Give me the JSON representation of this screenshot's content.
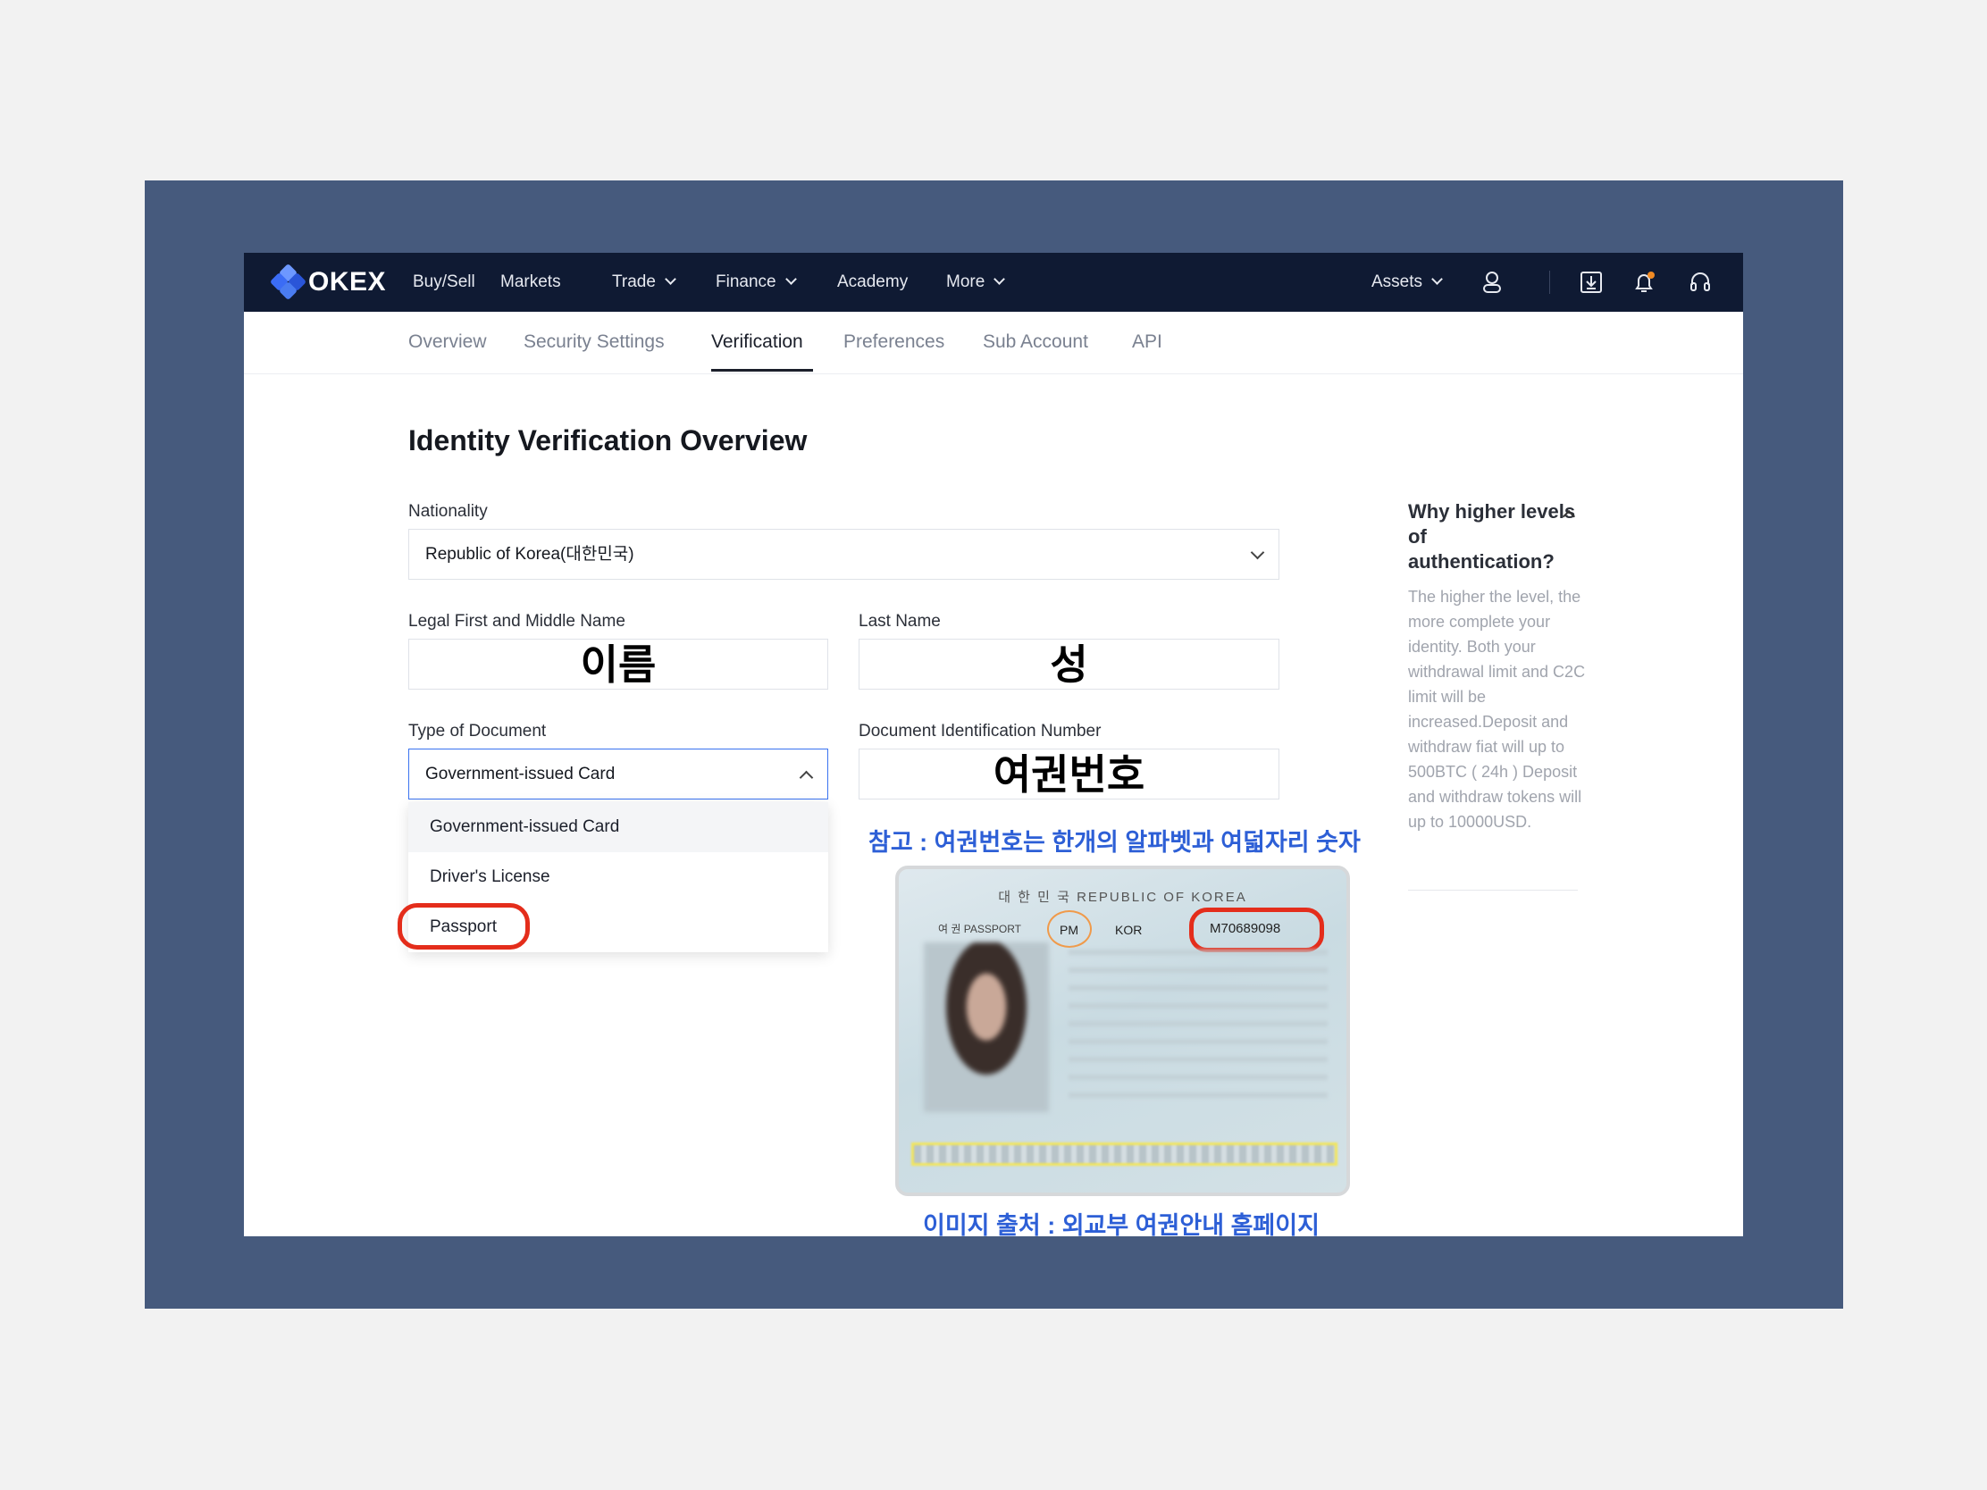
{
  "brand": {
    "name": "OKEX"
  },
  "topnav": {
    "items": [
      "Buy/Sell",
      "Markets",
      "Trade",
      "Finance",
      "Academy",
      "More"
    ],
    "assets_label": "Assets"
  },
  "subnav": {
    "tabs": [
      "Overview",
      "Security Settings",
      "Verification",
      "Preferences",
      "Sub Account",
      "API"
    ],
    "active": "Verification"
  },
  "page": {
    "title": "Identity Verification Overview"
  },
  "form": {
    "nationality_label": "Nationality",
    "nationality_value": "Republic of Korea(대한민국)",
    "first_name_label": "Legal First and Middle Name",
    "first_name_value": "이름",
    "last_name_label": "Last Name",
    "last_name_value": "성",
    "doc_type_label": "Type of Document",
    "doc_type_value": "Government-issued Card",
    "doc_number_label": "Document Identification Number",
    "doc_number_value": "여권번호",
    "doc_type_options": [
      "Government-issued Card",
      "Driver's License",
      "Passport"
    ]
  },
  "side": {
    "title": "Why higher levels of authentication?",
    "body": "The higher the level, the more complete your identity. Both your withdrawal limit and C2C limit will be increased.Deposit and withdraw fiat will up to 500BTC ( 24h ) Deposit and withdraw tokens will up to 10000USD."
  },
  "annotation": {
    "note": "참고 : 여권번호는 한개의 알파벳과 여덟자리 숫자",
    "credit": "이미지 출처 : 외교부 여권안내 홈페이지"
  },
  "passport": {
    "header": "대 한 민 국   REPUBLIC OF KOREA",
    "type_label": "여 권   PASSPORT",
    "type_value": "PM",
    "country_value": "KOR",
    "number_value": "M70689098"
  },
  "colors": {
    "nav_bg": "#0f1a33",
    "frame": "#465a7d",
    "accent": "#3a73f0",
    "annotation": "#2d5fd6",
    "highlight": "#e42d1b"
  }
}
